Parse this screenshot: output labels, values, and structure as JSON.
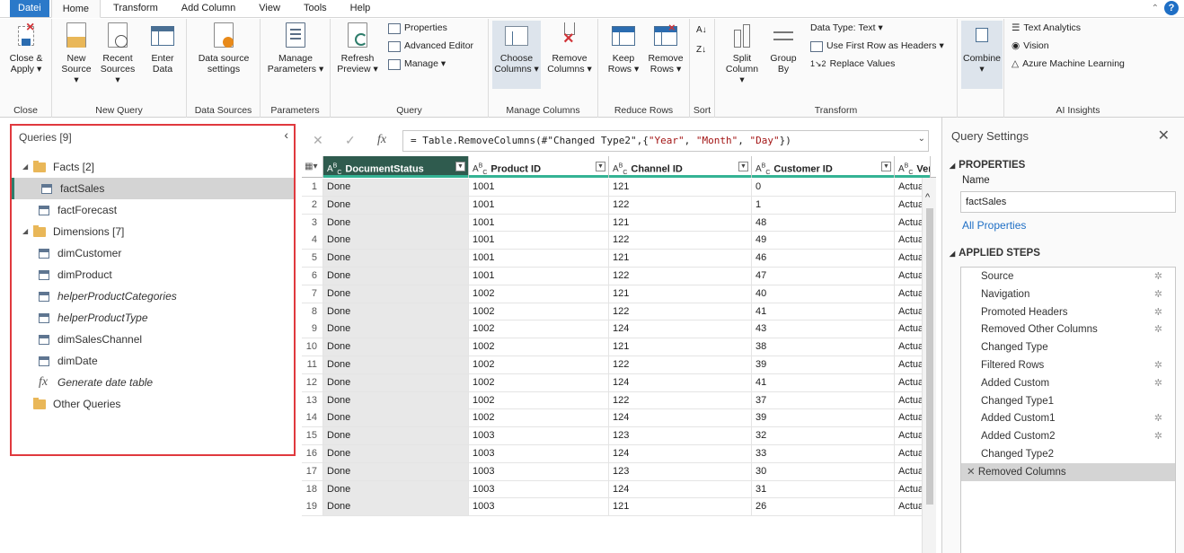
{
  "tabs": [
    "Datei",
    "Home",
    "Transform",
    "Add Column",
    "View",
    "Tools",
    "Help"
  ],
  "ribbon": {
    "close": {
      "btn": "Close & Apply ▾",
      "label": "Close"
    },
    "new_query": {
      "new_source": "New Source ▾",
      "recent_sources": "Recent Sources ▾",
      "enter_data": "Enter Data",
      "label": "New Query"
    },
    "data_sources": {
      "btn": "Data source settings",
      "label": "Data Sources"
    },
    "parameters": {
      "btn": "Manage Parameters ▾",
      "label": "Parameters"
    },
    "query": {
      "refresh": "Refresh Preview ▾",
      "properties": "Properties",
      "advanced_editor": "Advanced Editor",
      "manage": "Manage ▾",
      "label": "Query"
    },
    "manage_columns": {
      "choose": "Choose Columns ▾",
      "remove": "Remove Columns ▾",
      "label": "Manage Columns"
    },
    "reduce_rows": {
      "keep": "Keep Rows ▾",
      "remove": "Remove Rows ▾",
      "label": "Reduce Rows"
    },
    "sort": {
      "label": "Sort"
    },
    "transform": {
      "split": "Split Column ▾",
      "group": "Group By",
      "data_type": "Data Type: Text ▾",
      "first_row": "Use First Row as Headers ▾",
      "replace": "Replace Values",
      "label": "Transform"
    },
    "combine": {
      "btn": "Combine ▾"
    },
    "ai": {
      "text": "Text Analytics",
      "vision": "Vision",
      "aml": "Azure Machine Learning",
      "label": "AI Insights"
    }
  },
  "queries": {
    "header": "Queries [9]",
    "items": [
      {
        "type": "folder",
        "label": "Facts [2]",
        "indent": 0
      },
      {
        "type": "table",
        "label": "factSales",
        "indent": 1,
        "selected": true
      },
      {
        "type": "table",
        "label": "factForecast",
        "indent": 1
      },
      {
        "type": "folder",
        "label": "Dimensions [7]",
        "indent": 0
      },
      {
        "type": "table",
        "label": "dimCustomer",
        "indent": 1
      },
      {
        "type": "table",
        "label": "dimProduct",
        "indent": 1
      },
      {
        "type": "table",
        "label": "helperProductCategories",
        "indent": 1,
        "italic": true
      },
      {
        "type": "table",
        "label": "helperProductType",
        "indent": 1,
        "italic": true
      },
      {
        "type": "table",
        "label": "dimSalesChannel",
        "indent": 1
      },
      {
        "type": "table",
        "label": "dimDate",
        "indent": 1
      },
      {
        "type": "fx",
        "label": "Generate date table",
        "indent": 1,
        "italic": true
      },
      {
        "type": "folder2",
        "label": "Other Queries",
        "indent": 0
      }
    ]
  },
  "formula": {
    "prefix": "= Table.RemoveColumns(#\"Changed Type2\",{",
    "s1": "\"Year\"",
    "sep1": ", ",
    "s2": "\"Month\"",
    "sep2": ", ",
    "s3": "\"Day\"",
    "suffix": "})"
  },
  "grid": {
    "columns": [
      "DocumentStatus",
      "Product ID",
      "Channel ID",
      "Customer ID",
      "Vers"
    ],
    "rows": [
      [
        "1",
        "Done",
        "1001",
        "121",
        "0",
        "Actua"
      ],
      [
        "2",
        "Done",
        "1001",
        "122",
        "1",
        "Actua"
      ],
      [
        "3",
        "Done",
        "1001",
        "121",
        "48",
        "Actua"
      ],
      [
        "4",
        "Done",
        "1001",
        "122",
        "49",
        "Actua"
      ],
      [
        "5",
        "Done",
        "1001",
        "121",
        "46",
        "Actua"
      ],
      [
        "6",
        "Done",
        "1001",
        "122",
        "47",
        "Actua"
      ],
      [
        "7",
        "Done",
        "1002",
        "121",
        "40",
        "Actua"
      ],
      [
        "8",
        "Done",
        "1002",
        "122",
        "41",
        "Actua"
      ],
      [
        "9",
        "Done",
        "1002",
        "124",
        "43",
        "Actua"
      ],
      [
        "10",
        "Done",
        "1002",
        "121",
        "38",
        "Actua"
      ],
      [
        "11",
        "Done",
        "1002",
        "122",
        "39",
        "Actua"
      ],
      [
        "12",
        "Done",
        "1002",
        "124",
        "41",
        "Actua"
      ],
      [
        "13",
        "Done",
        "1002",
        "122",
        "37",
        "Actua"
      ],
      [
        "14",
        "Done",
        "1002",
        "124",
        "39",
        "Actua"
      ],
      [
        "15",
        "Done",
        "1003",
        "123",
        "32",
        "Actua"
      ],
      [
        "16",
        "Done",
        "1003",
        "124",
        "33",
        "Actua"
      ],
      [
        "17",
        "Done",
        "1003",
        "123",
        "30",
        "Actua"
      ],
      [
        "18",
        "Done",
        "1003",
        "124",
        "31",
        "Actua"
      ],
      [
        "19",
        "Done",
        "1003",
        "121",
        "26",
        "Actua"
      ]
    ]
  },
  "settings": {
    "title": "Query Settings",
    "properties": "PROPERTIES",
    "name_label": "Name",
    "name_value": "factSales",
    "all_properties": "All Properties",
    "applied_steps": "APPLIED STEPS",
    "steps": [
      {
        "label": "Source",
        "gear": true
      },
      {
        "label": "Navigation",
        "gear": true
      },
      {
        "label": "Promoted Headers",
        "gear": true
      },
      {
        "label": "Removed Other Columns",
        "gear": true
      },
      {
        "label": "Changed Type",
        "gear": false
      },
      {
        "label": "Filtered Rows",
        "gear": true
      },
      {
        "label": "Added Custom",
        "gear": true
      },
      {
        "label": "Changed Type1",
        "gear": false
      },
      {
        "label": "Added Custom1",
        "gear": true
      },
      {
        "label": "Added Custom2",
        "gear": true
      },
      {
        "label": "Changed Type2",
        "gear": false
      },
      {
        "label": "Removed Columns",
        "gear": false,
        "selected": true
      }
    ]
  },
  "colors": {
    "accent": "#2b79c9",
    "selected_col": "#2f5b4e",
    "highlight_border": "#e0393e",
    "quality_bar": "#34b394"
  }
}
